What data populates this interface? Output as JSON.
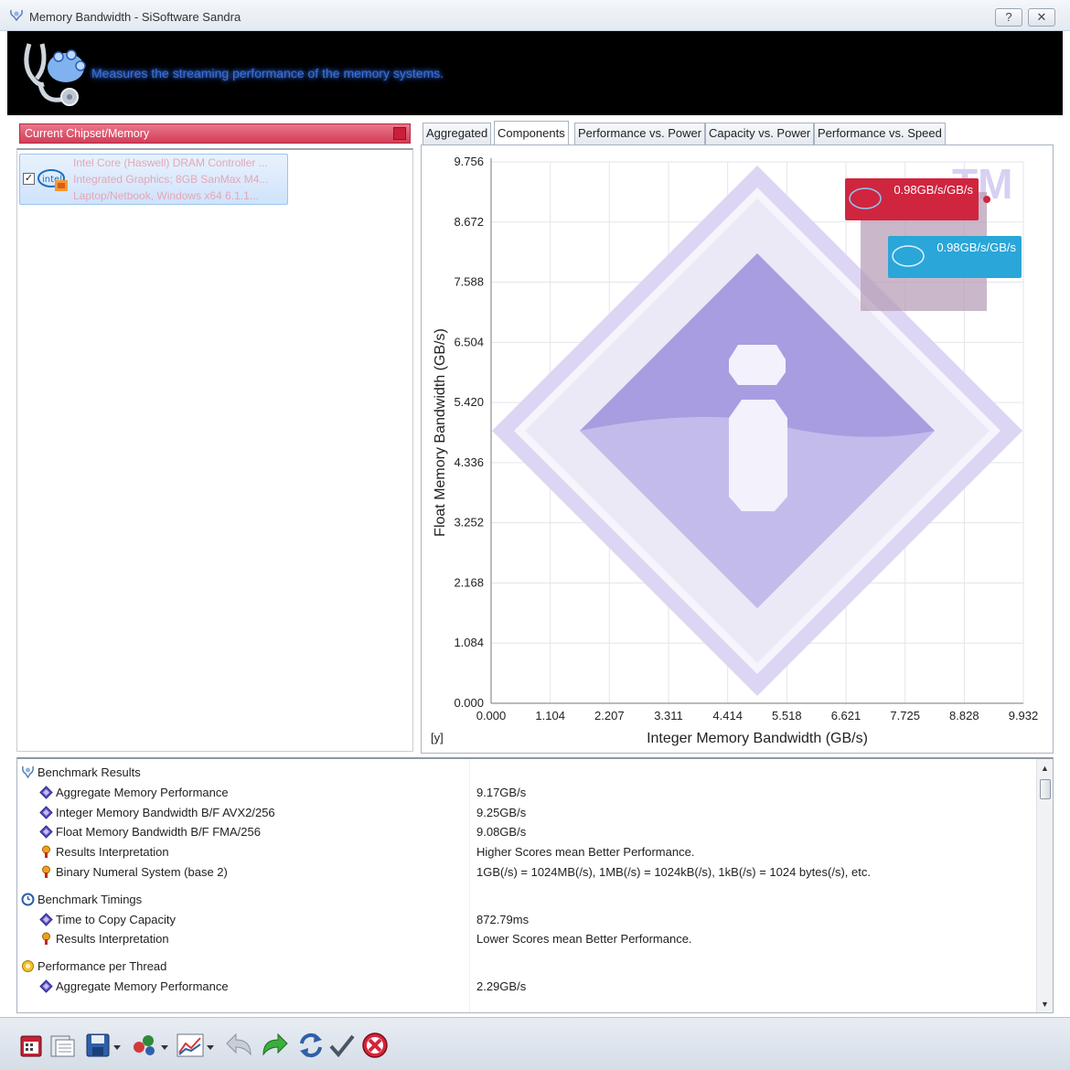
{
  "window": {
    "title": "Memory Bandwidth - SiSoftware Sandra",
    "help_label": "?",
    "close_label": "✕"
  },
  "banner": {
    "description": "Measures the streaming performance of the memory systems."
  },
  "left_panel": {
    "header": "Current Chipset/Memory",
    "device": {
      "checked": true,
      "checkbox_label": "✓",
      "lines": [
        "Intel Core (Haswell) DRAM Controller ...",
        "Integrated Graphics; 8GB SanMax M4...",
        "Laptop/Netbook, Windows x64 6.1.1..."
      ]
    }
  },
  "tabs": [
    {
      "label": "Aggregated",
      "active": false
    },
    {
      "label": "Components",
      "active": true
    },
    {
      "label": "Performance vs. Power",
      "active": false
    },
    {
      "label": "Capacity vs. Power",
      "active": false
    },
    {
      "label": "Performance vs. Speed",
      "active": false
    }
  ],
  "chart_data": {
    "type": "scatter",
    "title": "",
    "xlabel": "Integer Memory Bandwidth (GB/s)",
    "ylabel": "Float Memory Bandwidth (GB/s)",
    "corner_label": "[y]",
    "xlim": [
      0,
      9.932
    ],
    "ylim": [
      0,
      9.756
    ],
    "x_ticks": [
      "0.000",
      "1.104",
      "2.207",
      "3.311",
      "4.414",
      "5.518",
      "6.621",
      "7.725",
      "8.828",
      "9.932"
    ],
    "y_ticks": [
      "0.000",
      "1.084",
      "2.168",
      "3.252",
      "4.336",
      "5.420",
      "6.504",
      "7.588",
      "8.672",
      "9.756"
    ],
    "grid": true,
    "watermark_text": "TM",
    "series": [
      {
        "x": 9.25,
        "y": 9.08,
        "label": "0.98GB/s/GB/s",
        "color": "#d0253f"
      },
      {
        "label": "0.98GB/s/GB/s",
        "color": "#2aa6d8"
      }
    ]
  },
  "results": {
    "rows": [
      {
        "level": 0,
        "icon": "benchmark-results-icon",
        "label": "Benchmark Results",
        "value": ""
      },
      {
        "level": 1,
        "icon": "diamond-icon",
        "label": "Aggregate Memory Performance",
        "value": "9.17GB/s"
      },
      {
        "level": 1,
        "icon": "diamond-icon",
        "label": "Integer Memory Bandwidth B/F AVX2/256",
        "value": "9.25GB/s"
      },
      {
        "level": 1,
        "icon": "diamond-icon",
        "label": "Float Memory Bandwidth B/F FMA/256",
        "value": "9.08GB/s"
      },
      {
        "level": 1,
        "icon": "tip-icon",
        "label": "Results Interpretation",
        "value": "Higher Scores mean Better Performance."
      },
      {
        "level": 1,
        "icon": "tip-icon",
        "label": "Binary Numeral System (base 2)",
        "value": "1GB(/s) = 1024MB(/s), 1MB(/s) = 1024kB(/s), 1kB(/s) = 1024 bytes(/s), etc."
      },
      {
        "level": 0,
        "icon": "timer-icon",
        "label": "Benchmark Timings",
        "value": ""
      },
      {
        "level": 1,
        "icon": "diamond-icon",
        "label": "Time to Copy Capacity",
        "value": "872.79ms"
      },
      {
        "level": 1,
        "icon": "tip-icon",
        "label": "Results Interpretation",
        "value": "Lower Scores mean Better Performance."
      },
      {
        "level": 0,
        "icon": "thread-icon",
        "label": "Performance per Thread",
        "value": ""
      },
      {
        "level": 1,
        "icon": "diamond-icon",
        "label": "Aggregate Memory Performance",
        "value": "2.29GB/s"
      }
    ]
  },
  "toolbar": {
    "buttons": [
      "calendar-icon",
      "report-icon",
      "save-icon",
      "options-icon",
      "chart-icon",
      "undo-icon",
      "redo-icon",
      "refresh-icon",
      "ok-icon",
      "cancel-icon"
    ]
  }
}
